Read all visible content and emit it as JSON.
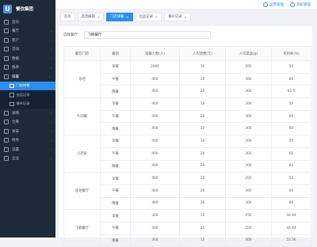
{
  "app": {
    "title": "餐饮集团",
    "logo_letter": "U"
  },
  "sidebar": {
    "items": [
      {
        "label": "首页",
        "icon": "home-icon"
      },
      {
        "label": "餐厅",
        "icon": "store-icon",
        "chevron": "›"
      },
      {
        "label": "客户",
        "icon": "user-icon",
        "chevron": "›"
      },
      {
        "label": "活动",
        "icon": "activity-icon",
        "chevron": "›"
      },
      {
        "label": "数据",
        "icon": "chart-icon",
        "chevron": "›"
      },
      {
        "label": "报表",
        "icon": "report-icon",
        "chevron": "›"
      },
      {
        "label": "排餐",
        "icon": "calendar-icon",
        "chevron": "⌄",
        "open": true
      },
      {
        "label": "门店排餐",
        "icon": "doc-icon",
        "sub": true,
        "active": true
      },
      {
        "label": "出品记录",
        "icon": "doc-icon",
        "sub": true
      },
      {
        "label": "餐补记录",
        "icon": "doc-icon",
        "sub": true
      },
      {
        "label": "采购",
        "icon": "cart-icon",
        "chevron": "›"
      },
      {
        "label": "仓库",
        "icon": "warehouse-icon",
        "chevron": "›"
      },
      {
        "label": "食安",
        "icon": "shield-icon",
        "chevron": "›"
      },
      {
        "label": "财务",
        "icon": "money-icon",
        "chevron": "›"
      },
      {
        "label": "设置",
        "icon": "gear-icon",
        "chevron": "›"
      },
      {
        "label": "企业",
        "icon": "building-icon",
        "chevron": "›"
      }
    ]
  },
  "topbar": {
    "workbench": "运营管理",
    "system": "系统管理"
  },
  "tabs": [
    {
      "label": "首页",
      "closable": false
    },
    {
      "label": "菜谱编辑",
      "closable": true
    },
    {
      "label": "门店排餐",
      "closable": true,
      "active": true
    },
    {
      "label": "出品记录",
      "closable": true
    },
    {
      "label": "餐补记录",
      "closable": true
    }
  ],
  "filter": {
    "label": "选择餐厅：",
    "value": "飞鹅餐厅"
  },
  "table": {
    "headers": [
      "餐饮门店",
      "餐别",
      "就餐人数(人)",
      "人均消费(元)",
      "人均菜品(g)",
      "毛利率(%)"
    ],
    "groups": [
      {
        "name": "东吧",
        "rows": [
          [
            "早餐",
            "2000",
            "10",
            "200",
            "50"
          ],
          [
            "午餐",
            "400",
            "20",
            "300",
            "60"
          ],
          [
            "晚餐",
            "400",
            "20",
            "300",
            "62.5"
          ]
        ]
      },
      {
        "name": "午间餐",
        "rows": [
          [
            "早餐",
            "400",
            "10",
            "200",
            "50"
          ],
          [
            "午餐",
            "400",
            "20",
            "300",
            "60"
          ],
          [
            "晚餐",
            "400",
            "20",
            "300",
            "60"
          ]
        ]
      },
      {
        "name": "小西房",
        "rows": [
          [
            "早餐",
            "400",
            "10",
            "200",
            "50"
          ],
          [
            "午餐",
            "400",
            "20",
            "300",
            "60"
          ],
          [
            "晚餐",
            "400",
            "20",
            "300",
            "60"
          ]
        ]
      },
      {
        "name": "佐佐餐厅",
        "rows": [
          [
            "早餐",
            "400",
            "10",
            "200",
            "50"
          ],
          [
            "午餐",
            "400",
            "20",
            "300",
            "60"
          ],
          [
            "晚餐",
            "400",
            "20",
            "300",
            "60"
          ]
        ]
      },
      {
        "name": "飞鹅餐厅",
        "rows": [
          [
            "早餐",
            "300",
            "15",
            "250",
            "44.44"
          ],
          [
            "午餐",
            "300",
            "15",
            "250",
            "44.44"
          ],
          [
            "晚餐",
            "300",
            "15",
            "400",
            "55.56"
          ]
        ]
      }
    ]
  }
}
